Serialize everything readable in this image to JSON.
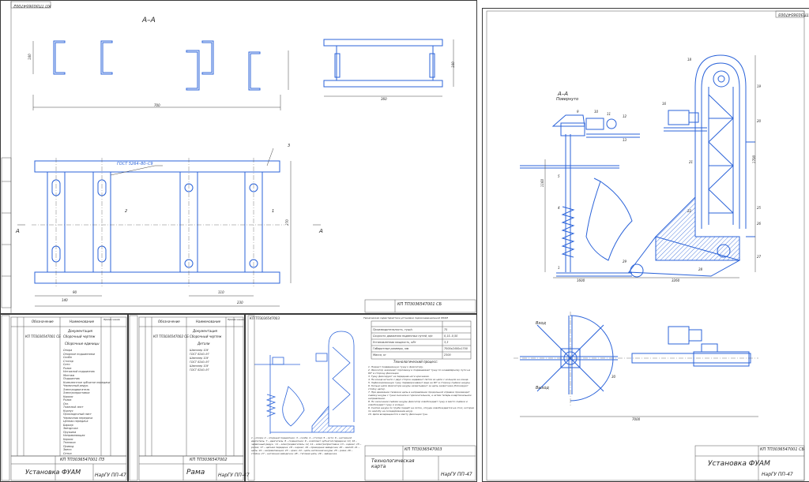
{
  "sheets": {
    "frame": {
      "section_label": "A–A",
      "dims_top": [
        "100",
        "700",
        "360",
        "100"
      ],
      "dims_plan": [
        "140",
        "90",
        "110",
        "230",
        "270"
      ],
      "weld_note": "ГОСТ 5264–80–С9",
      "pos_numbers": [
        "1",
        "2",
        "3"
      ],
      "arrow_label": "A",
      "stamp_code": "КП ТП3036547002",
      "stamp_title": "Рама",
      "stamp_group": "НарГУ ПП-47"
    },
    "install": {
      "section_label": "А–А",
      "section_sub": "Повернуто",
      "dims": [
        "1600",
        "3260",
        "1160",
        "1700",
        "7000"
      ],
      "label_in": "Вход",
      "label_out": "Выход",
      "stamp_code": "КП ТП3036547001 СБ",
      "stamp_title": "Установка ФУАМ",
      "stamp_group": "НарГУ ПП-47",
      "positions": [
        "1",
        "2",
        "3",
        "4",
        "5",
        "6",
        "7",
        "8",
        "9",
        "10",
        "11",
        "12",
        "13",
        "14",
        "15",
        "16",
        "17",
        "18",
        "19",
        "20",
        "21",
        "22",
        "23",
        "24",
        "25",
        "26",
        "27",
        "28",
        "29",
        "30"
      ]
    },
    "spec1": {
      "headers": [
        "Обозначение",
        "Наименование",
        "Приме-чание"
      ],
      "doc_section": "Документация",
      "doc_row": "КП ТП3036547001 СБ",
      "doc_name": "Сборочный чертеж",
      "section_units": "Сборочные единицы",
      "items": [
        "Опора",
        "Опорные подшипники",
        "Скоба",
        "Стопор",
        "Сито",
        "Ролик",
        "Натяжной подшипник",
        "Монтаж",
        "Подшипник",
        "Комплектное зубчатое передачи",
        "Червячный редук.",
        "Электродвигатель",
        "Электроприставка",
        "Каркас",
        "Ролик",
        "Ось",
        "Тяжелый лист",
        "Корпус",
        "Прокладочный лист",
        "Червячная передача",
        "Цепная передача",
        "Барьер",
        "Звездочка",
        "Пружина",
        "Направляющая",
        "Каркас",
        "Тележка",
        "Привод",
        "Звено",
        "Сетка"
      ],
      "stamp_code": "КП ТП3036547001 ПЗ",
      "stamp_title": "Установка ФУАМ",
      "stamp_group": "НарГУ ПП-47"
    },
    "spec2": {
      "headers": [
        "Обозначение",
        "Наименование",
        "Приме-чание"
      ],
      "doc_section": "Документация",
      "doc_row": "КП ТП3036547002 СБ",
      "doc_name": "Сборочный чертеж",
      "section_units": "Детали",
      "items": [
        "Швеллер 10У",
        "ГОСТ 8240–97",
        "Швеллер 10У",
        "ГОСТ 8240–97",
        "Швеллер 10У",
        "ГОСТ 8240–97"
      ],
      "stamp_code": "КП ТП3036547002",
      "stamp_title": "Рама",
      "stamp_group": "НарГУ ПП-47"
    },
    "tech": {
      "table_title": "Техническая характеристика установки пароконвекционной ФУАМ",
      "rows": [
        [
          "Производительность, туш/ч",
          "75"
        ],
        [
          "Скорость движения подвесных путей, м/с",
          "0,15..0,50"
        ],
        [
          "Установленная мощность, кВт",
          "3,3"
        ],
        [
          "Габаритные размеры, мм",
          "7000х2400х1700"
        ],
        [
          "Масса, кг",
          "2300"
        ]
      ],
      "process_title": "Технологический процесс:",
      "process": [
        "1. Подают подвешенную тушу к фиксатору.",
        "2. Фиксатор зажимает горловину и подвешивает тушу по конвейерному пути на 90° в сторону фиксации.",
        "3. Тушу фиксируют за передние ноги крючками.",
        "4. На конце штанги с двух сторон надевают петли из цепи с кольцом на конце.",
        "5. Зафиксированную тушу переворачивают еще на 90° в сторону съёмки шкуры.",
        "6. Кольцо цепи фиксатора шкуры захватывают за цепь захватчика (блокируют стойку цепи).",
        "7. При движении тележки цепь в направлении продольной оправки производит съёмку шкуры с туши сначала в горизонтальном, а затем теперь в вертикальном направлении.",
        "8. По окончании съёмки шкуры фиксатор освобождает тушу и место съёмки и освобождает тушу и кольцо.",
        "9. Снятая шкура по трубе подаёт на лоток, откуда освобождается на стол, которая по желобу на складирование шкур.",
        "10. Цепи возвращаются к месту фиксации туш."
      ],
      "legend": "1 – опора; 2 – опорный подшипник; 3 – скоба; 4 – стопор; 5 – сито; 6 – натяжной двигатель; 7 – двигатель; 8 – подшипник; 9 – комплект зубчатой передачи; 10, 16 – червячный редук.; 11 – электродвигатель; 12, 14 – электроприставка; 13 – каркас; 15 – ролик; 17 – цепная передача; 18 – каркас; 19 – приводная звёздочка; 20 – желоб; 21 – цепь; 22 – направляющая; 23 – крюк; 24 – цепь натяжная шкуры; 25 – рама; 26 – стойка; 27 – натяжная звёздочка; 28 – тяговая цепь; 29 – звёздочка.",
      "stamp_code": "КП ТП3036547003",
      "stamp_title": "Технологическая карта",
      "stamp_group": "НарГУ ПП-47"
    }
  },
  "colors": {
    "line": "#2b63d9",
    "frame": "#3a3a3a",
    "hatch": "#2b63d9"
  }
}
